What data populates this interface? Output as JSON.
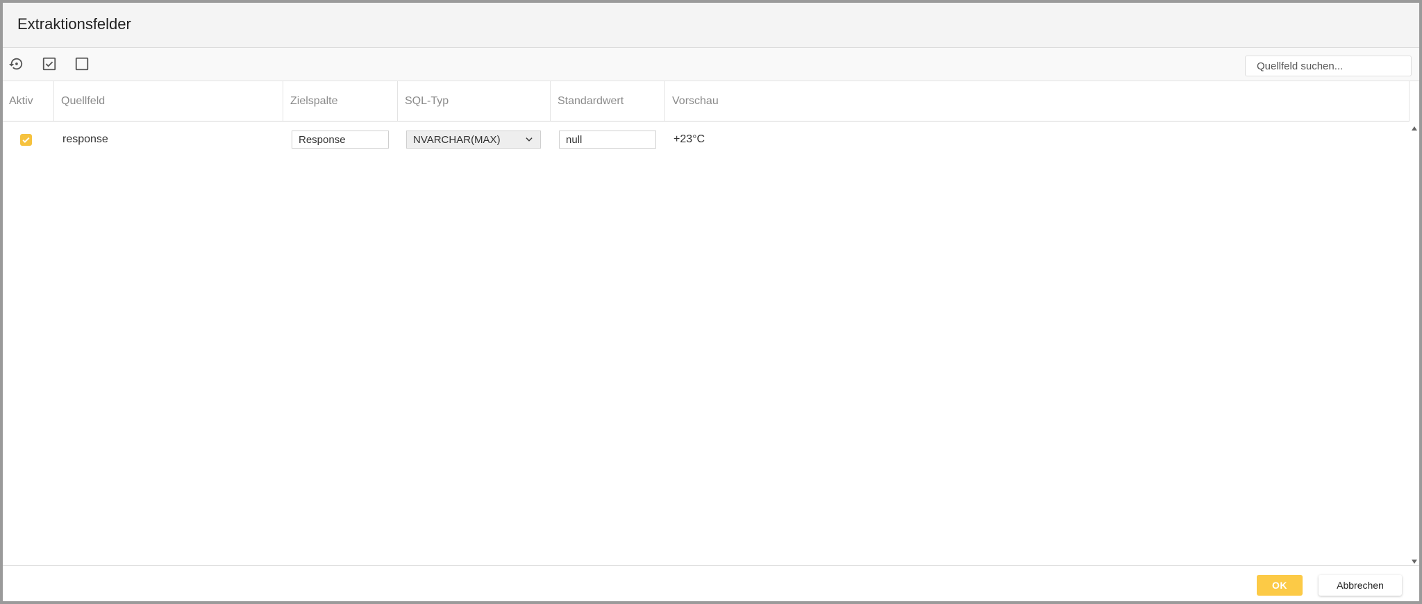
{
  "dialog": {
    "title": "Extraktionsfelder"
  },
  "toolbar": {
    "buttons": [
      {
        "icon": "reset-icon"
      },
      {
        "icon": "check-all-icon"
      },
      {
        "icon": "uncheck-all-icon"
      }
    ],
    "search_placeholder": "Quellfeld suchen..."
  },
  "table": {
    "columns": [
      "Aktiv",
      "Quellfeld",
      "Zielspalte",
      "SQL-Typ",
      "Standardwert",
      "Vorschau"
    ],
    "rows": [
      {
        "active": true,
        "source_field": "response",
        "target_column": "Response",
        "sql_type": "NVARCHAR(MAX)",
        "default_value": "null",
        "preview": "+23°C"
      }
    ]
  },
  "footer": {
    "ok_label": "OK",
    "cancel_label": "Abbrechen"
  },
  "colors": {
    "accent": "#fcca46",
    "checkbox": "#f6c23e"
  }
}
